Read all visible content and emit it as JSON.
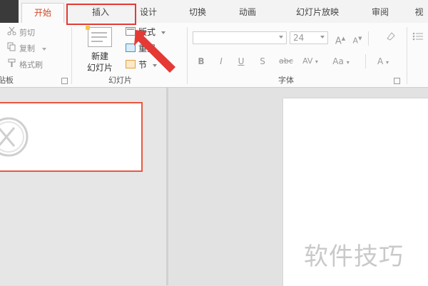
{
  "tabs": [
    {
      "label": "开始",
      "active": true
    },
    {
      "label": "插入",
      "active": false
    },
    {
      "label": "设计",
      "active": false
    },
    {
      "label": "切换",
      "active": false
    },
    {
      "label": "动画",
      "active": false
    },
    {
      "label": "幻灯片放映",
      "active": false
    },
    {
      "label": "审阅",
      "active": false
    },
    {
      "label": "视",
      "active": false
    }
  ],
  "clipboard": {
    "cut": "剪切",
    "copy": "复制",
    "format_painter": "格式刷",
    "group_label": "剪贴板"
  },
  "slides": {
    "new_slide_line1": "新建",
    "new_slide_line2": "幻灯片",
    "layout": "版式",
    "reset": "重置",
    "section": "节",
    "group_label": "幻灯片"
  },
  "font": {
    "font_name": "",
    "font_size": "24",
    "bold": "B",
    "italic": "I",
    "underline": "U",
    "shadow": "S",
    "strike": "abc",
    "spacing": "AV",
    "case": "Aa",
    "color": "A",
    "group_label": "字体"
  },
  "watermark": "软件技巧",
  "colors": {
    "active_tab": "#d24726",
    "highlight": "#e53935",
    "thumb_border": "#e9573f"
  }
}
